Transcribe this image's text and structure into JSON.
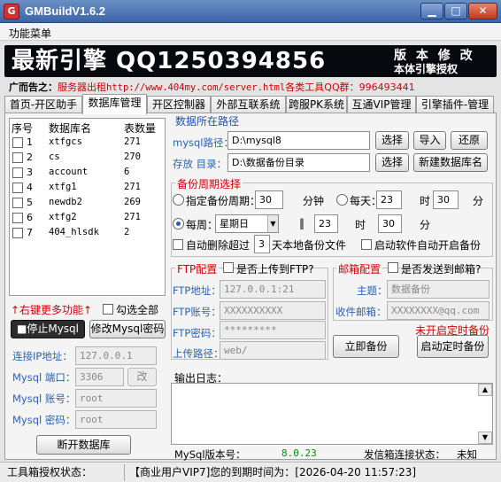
{
  "window": {
    "title": "GMBuildV1.6.2",
    "icon": "app-icon"
  },
  "menu": {
    "items": [
      "功能菜单"
    ]
  },
  "banner": {
    "main": "最新引擎 QQ1250394856",
    "right_line1": "版 本 修 改",
    "right_line2": "本体引擎授权"
  },
  "ad": {
    "label": "广而告之：",
    "text1": "服务器出租",
    "url": "http://www.404my.com/server.html",
    "text2": "各类工具QQ群：996493441"
  },
  "tabs": [
    "首页-开区助手",
    "数据库管理",
    "开区控制器",
    "外部互联系统",
    "跨服PK系统",
    "互通VIP管理",
    "引擎插件-管理"
  ],
  "active_tab": 1,
  "db_list": {
    "headers": [
      "序号",
      "数据库名",
      "表数量"
    ],
    "rows": [
      {
        "no": "1",
        "name": "xtfgcs",
        "count": "271"
      },
      {
        "no": "2",
        "name": "cs",
        "count": "270"
      },
      {
        "no": "3",
        "name": "account",
        "count": "6"
      },
      {
        "no": "4",
        "name": "xtfg1",
        "count": "271"
      },
      {
        "no": "5",
        "name": "newdb2",
        "count": "269"
      },
      {
        "no": "6",
        "name": "xtfg2",
        "count": "271"
      },
      {
        "no": "7",
        "name": "404_hlsdk",
        "count": "2"
      }
    ]
  },
  "left": {
    "hint": "↑右键更多功能↑",
    "select_all": "勾选全部",
    "stop_mysql": "■停止Mysql",
    "modify_pwd": "修改Mysql密码",
    "ip_label": "连接IP地址：",
    "ip_value": "127.0.0.1",
    "port_label": "Mysql 端口：",
    "port_value": "3306",
    "port_change": "改",
    "account_label": "Mysql 账号：",
    "account_value": "root",
    "password_label": "Mysql 密码：",
    "password_value": "root",
    "disconnect": "断开数据库"
  },
  "path": {
    "title": "数据所在路径",
    "mysql_label": "mysql路径：",
    "mysql_value": "D:\\mysql8",
    "store_label": "存放 目录：",
    "store_value": "D:\\数据备份目录",
    "browse": "选择",
    "browse2": "选择",
    "import": "导入",
    "restore": "还原",
    "new_db": "新建数据库名"
  },
  "backup": {
    "title": "备份周期选择",
    "interval_label": "指定备份周期：",
    "interval_value": "30",
    "interval_unit": "分钟",
    "daily_label": "每天：",
    "daily_hour": "23",
    "hour_unit": "时",
    "daily_min": "30",
    "min_unit": "分",
    "weekly_label": "每周：",
    "weekly_day": "星期日",
    "sep": "‖",
    "weekly_hour": "23",
    "weekly_hour_unit": "时",
    "weekly_min": "30",
    "weekly_min_unit": "分",
    "auto_delete_label": "自动删除超过",
    "auto_delete_days": "3",
    "auto_delete_suffix": "天本地备份文件",
    "auto_start": "启动软件自动开启备份"
  },
  "ftp": {
    "title": "FTP配置",
    "upload_label": "是否上传到FTP?",
    "addr_label": "FTP地址：",
    "addr_value": "127.0.0.1:21",
    "user_label": "FTP账号：",
    "user_value": "XXXXXXXXXX",
    "pwd_label": "FTP密码：",
    "pwd_value": "*********",
    "path_label": "上传路径：",
    "path_value": "web/"
  },
  "mail": {
    "title": "邮箱配置",
    "send_label": "是否发送到邮箱?",
    "subject_label": "主题：",
    "subject_value": "数据备份",
    "to_label": "收件邮箱：",
    "to_value": "XXXXXXXX@qq.com",
    "status": "未开启定时备份",
    "backup_now": "立即备份",
    "start_timer": "启动定时备份"
  },
  "log": {
    "title": "输出日志："
  },
  "footer": {
    "mysql_version_label": "MySql版本号：",
    "mysql_version_value": "8.0.23",
    "mail_status_label": "发信箱连接状态：",
    "mail_status_value": "未知"
  },
  "statusbar": {
    "label": "工具箱授权状态：",
    "value": "【商业用户VIP7]您的到期时间为：[2026-04-20 11:57:23]"
  },
  "colors": {
    "accent_red": "#d40000",
    "label_blue": "#2d62b7",
    "title_blue": "#3c64a8",
    "version_green": "#0a8a0a"
  }
}
